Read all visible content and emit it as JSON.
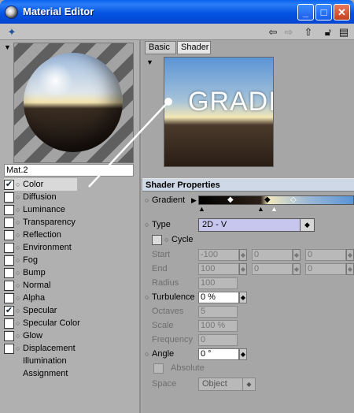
{
  "window": {
    "title": "Material Editor"
  },
  "titlebar_buttons": {
    "minimize": "_",
    "maximize": "□",
    "close": "✕"
  },
  "toolbar": {
    "icons": [
      "pin-icon",
      "back-arrow-icon",
      "forward-arrow-icon",
      "up-arrow-icon",
      "lock-icon",
      "panel-icon"
    ]
  },
  "material": {
    "name": "Mat.2"
  },
  "channels": [
    {
      "label": "Color",
      "checked": true,
      "active": true,
      "box": true
    },
    {
      "label": "Diffusion",
      "checked": false,
      "box": true
    },
    {
      "label": "Luminance",
      "checked": false,
      "box": true
    },
    {
      "label": "Transparency",
      "checked": false,
      "box": true
    },
    {
      "label": "Reflection",
      "checked": false,
      "box": true
    },
    {
      "label": "Environment",
      "checked": false,
      "box": true
    },
    {
      "label": "Fog",
      "checked": false,
      "box": true
    },
    {
      "label": "Bump",
      "checked": false,
      "box": true
    },
    {
      "label": "Normal",
      "checked": false,
      "box": true
    },
    {
      "label": "Alpha",
      "checked": false,
      "box": true
    },
    {
      "label": "Specular",
      "checked": true,
      "box": true
    },
    {
      "label": "Specular Color",
      "checked": false,
      "box": true
    },
    {
      "label": "Glow",
      "checked": false,
      "box": true
    },
    {
      "label": "Displacement",
      "checked": false,
      "box": true
    },
    {
      "label": "Illumination",
      "checked": false,
      "box": false
    },
    {
      "label": "Assignment",
      "checked": false,
      "box": false
    }
  ],
  "tabs": [
    "Basic",
    "Shader"
  ],
  "shader_preview_label": "GRADIENT",
  "section_title": "Shader Properties",
  "props": {
    "gradient_label": "Gradient",
    "type_label": "Type",
    "type_value": "2D - V",
    "cycle_label": "Cycle",
    "start_label": "Start",
    "start_values": [
      "-100",
      "0",
      "0"
    ],
    "end_label": "End",
    "end_values": [
      "100",
      "0",
      "0"
    ],
    "radius_label": "Radius",
    "radius_value": "100",
    "turbulence_label": "Turbulence",
    "turbulence_value": "0 %",
    "octaves_label": "Octaves",
    "octaves_value": "5",
    "scale_label": "Scale",
    "scale_value": "100 %",
    "frequency_label": "Frequency",
    "frequency_value": "0",
    "angle_label": "Angle",
    "angle_value": "0 °",
    "absolute_label": "Absolute",
    "space_label": "Space",
    "space_value": "Object"
  },
  "colors": {
    "title_bar": "#0554e4",
    "panel": "#a6a6a6",
    "section_header": "#cfd8e6",
    "select_bg": "#c6c6ee"
  }
}
